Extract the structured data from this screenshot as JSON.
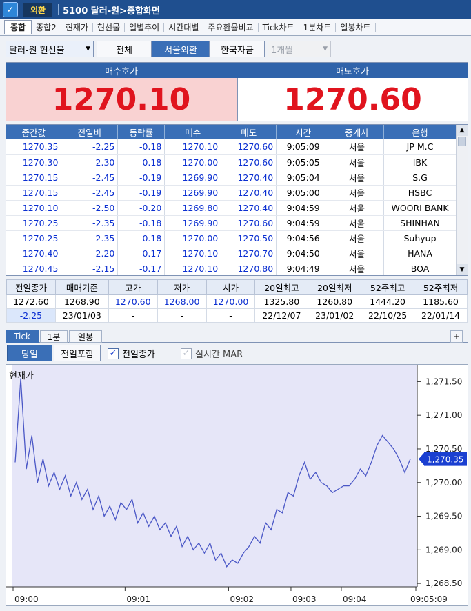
{
  "window": {
    "app_icon": "app-logo-icon",
    "badge": "외환",
    "title": "5100 달러-원>종합화면"
  },
  "tabs": [
    "종합",
    "종합2",
    "현재가",
    "현선물",
    "일별추이",
    "시간대별",
    "주요환율비교",
    "Tick차트",
    "1분차트",
    "일봉차트"
  ],
  "controls": {
    "instrument_select": "달러-원 현선물",
    "all_button": "전체",
    "seoul_button": "서울외환",
    "korea_button": "한국자금",
    "period_select": "1개월"
  },
  "quote": {
    "bid_label": "매수호가",
    "ask_label": "매도호가",
    "bid": "1270.10",
    "ask": "1270.60"
  },
  "ticks": {
    "headers": [
      "중간값",
      "전일비",
      "등락률",
      "매수",
      "매도",
      "시간",
      "중개사",
      "은행"
    ],
    "rows": [
      [
        "1270.35",
        "-2.25",
        "-0.18",
        "1270.10",
        "1270.60",
        "9:05:09",
        "서울",
        "JP M.C"
      ],
      [
        "1270.30",
        "-2.30",
        "-0.18",
        "1270.00",
        "1270.60",
        "9:05:05",
        "서울",
        "IBK"
      ],
      [
        "1270.15",
        "-2.45",
        "-0.19",
        "1269.90",
        "1270.40",
        "9:05:04",
        "서울",
        "S.G"
      ],
      [
        "1270.15",
        "-2.45",
        "-0.19",
        "1269.90",
        "1270.40",
        "9:05:00",
        "서울",
        "HSBC"
      ],
      [
        "1270.10",
        "-2.50",
        "-0.20",
        "1269.80",
        "1270.40",
        "9:04:59",
        "서울",
        "WOORI BANK"
      ],
      [
        "1270.25",
        "-2.35",
        "-0.18",
        "1269.90",
        "1270.60",
        "9:04:59",
        "서울",
        "SHINHAN"
      ],
      [
        "1270.25",
        "-2.35",
        "-0.18",
        "1270.00",
        "1270.50",
        "9:04:56",
        "서울",
        "Suhyup"
      ],
      [
        "1270.40",
        "-2.20",
        "-0.17",
        "1270.10",
        "1270.70",
        "9:04:50",
        "서울",
        "HANA"
      ],
      [
        "1270.45",
        "-2.15",
        "-0.17",
        "1270.10",
        "1270.80",
        "9:04:49",
        "서울",
        "BOA"
      ]
    ]
  },
  "summary": {
    "headers": [
      "전일종가",
      "매매기준",
      "고가",
      "저가",
      "시가",
      "20일최고",
      "20일최저",
      "52주최고",
      "52주최저"
    ],
    "row1": [
      "1272.60",
      "1268.90",
      "1270.60",
      "1268.00",
      "1270.00",
      "1325.80",
      "1260.80",
      "1444.20",
      "1185.60"
    ],
    "row2": [
      "-2.25",
      "23/01/03",
      "-",
      "-",
      "-",
      "22/12/07",
      "23/01/02",
      "22/10/25",
      "22/01/14"
    ]
  },
  "chart_tabs": [
    "Tick",
    "1분",
    "일봉"
  ],
  "chart_controls": {
    "today": "당일",
    "include_prev": "전일포함",
    "prev_close_label": "전일종가",
    "prev_close_checked": true,
    "realtime_mar_label": "실시간 MAR",
    "realtime_mar_checked": false
  },
  "chart_data": {
    "type": "area",
    "title": "현재가",
    "x_ticks": [
      "09:00",
      "09:01",
      "09:02",
      "09:03",
      "09:04",
      "09:05:09"
    ],
    "y_ticks": [
      "1,271.50",
      "1,271.00",
      "1,270.50",
      "1,270.00",
      "1,269.50",
      "1,269.00",
      "1,268.50"
    ],
    "ylim": [
      1268.45,
      1271.75
    ],
    "current_label": "1,270.35",
    "current_value": 1270.35,
    "colors": {
      "fill": "#dcdcf6",
      "line": "#4a57c6",
      "marker": "#1a3fd1"
    },
    "series": [
      {
        "values": [
          1270.3,
          1271.55,
          1270.2,
          1270.7,
          1270.0,
          1270.35,
          1269.95,
          1270.15,
          1269.9,
          1270.1,
          1269.8,
          1270.0,
          1269.75,
          1269.9,
          1269.6,
          1269.8,
          1269.5,
          1269.65,
          1269.45,
          1269.7,
          1269.6,
          1269.75,
          1269.4,
          1269.55,
          1269.35,
          1269.5,
          1269.3,
          1269.4,
          1269.2,
          1269.35,
          1269.05,
          1269.2,
          1269.0,
          1269.1,
          1268.95,
          1269.1,
          1268.85,
          1268.95,
          1268.75,
          1268.85,
          1268.8,
          1268.95,
          1269.05,
          1269.2,
          1269.1,
          1269.4,
          1269.3,
          1269.6,
          1269.55,
          1269.85,
          1269.8,
          1270.1,
          1270.3,
          1270.05,
          1270.15,
          1270.0,
          1269.95,
          1269.85,
          1269.9,
          1269.95,
          1269.95,
          1270.05,
          1270.2,
          1270.1,
          1270.3,
          1270.55,
          1270.7,
          1270.6,
          1270.5,
          1270.35,
          1270.15,
          1270.35
        ]
      }
    ]
  }
}
